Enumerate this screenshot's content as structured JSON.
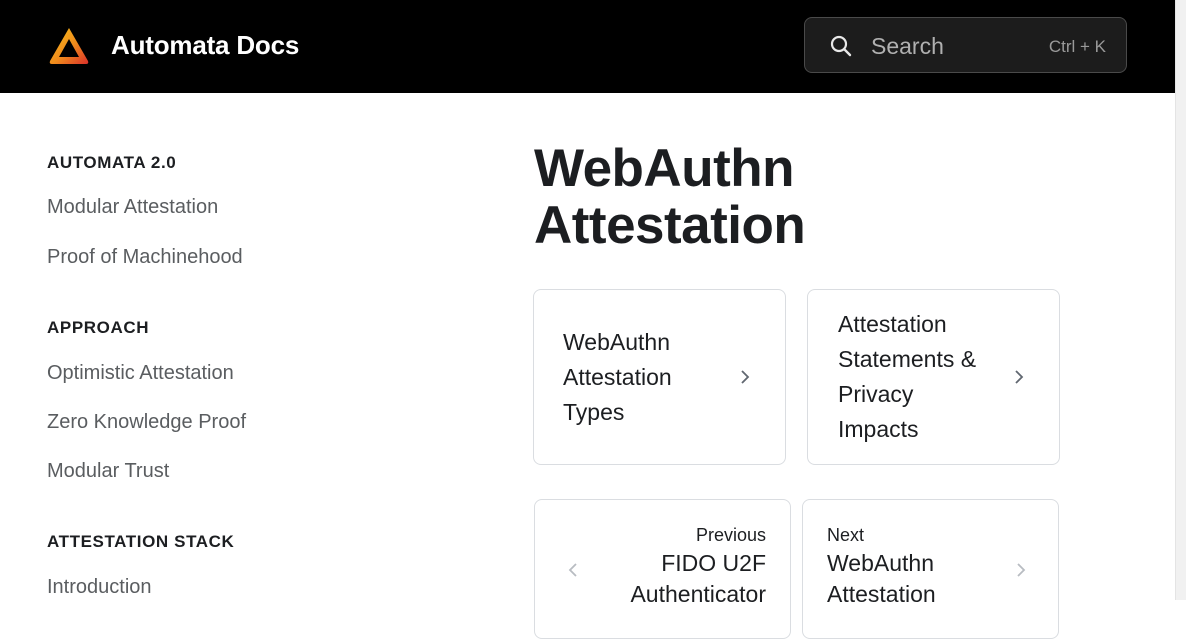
{
  "header": {
    "logo_icon": "automata-triangle-logo",
    "title": "Automata Docs",
    "search": {
      "icon": "search-icon",
      "placeholder": "Search",
      "shortcut": "Ctrl + K"
    }
  },
  "sidebar": {
    "sections": [
      {
        "title": "AUTOMATA 2.0",
        "items": [
          "Modular Attestation",
          "Proof of Machinehood"
        ]
      },
      {
        "title": "APPROACH",
        "items": [
          "Optimistic Attestation",
          "Zero Knowledge Proof",
          "Modular Trust"
        ]
      },
      {
        "title": "ATTESTATION STACK",
        "items": [
          "Introduction"
        ]
      }
    ]
  },
  "main": {
    "title_line1": "WebAuthn",
    "title_line2": "Attestation",
    "cards": [
      {
        "lines": [
          "WebAuthn",
          "Attestation",
          "Types"
        ]
      },
      {
        "lines": [
          "Attestation",
          "Statements &",
          "Privacy",
          "Impacts"
        ]
      }
    ],
    "pager": {
      "previous": {
        "label": "Previous",
        "line1": "FIDO U2F",
        "line2": "Authenticator"
      },
      "next": {
        "label": "Next",
        "line1": "WebAuthn",
        "line2": "Attestation"
      }
    }
  },
  "colors": {
    "header_bg": "#000000",
    "accent_logo_start": "#f7b500",
    "accent_logo_end": "#e2362b"
  }
}
